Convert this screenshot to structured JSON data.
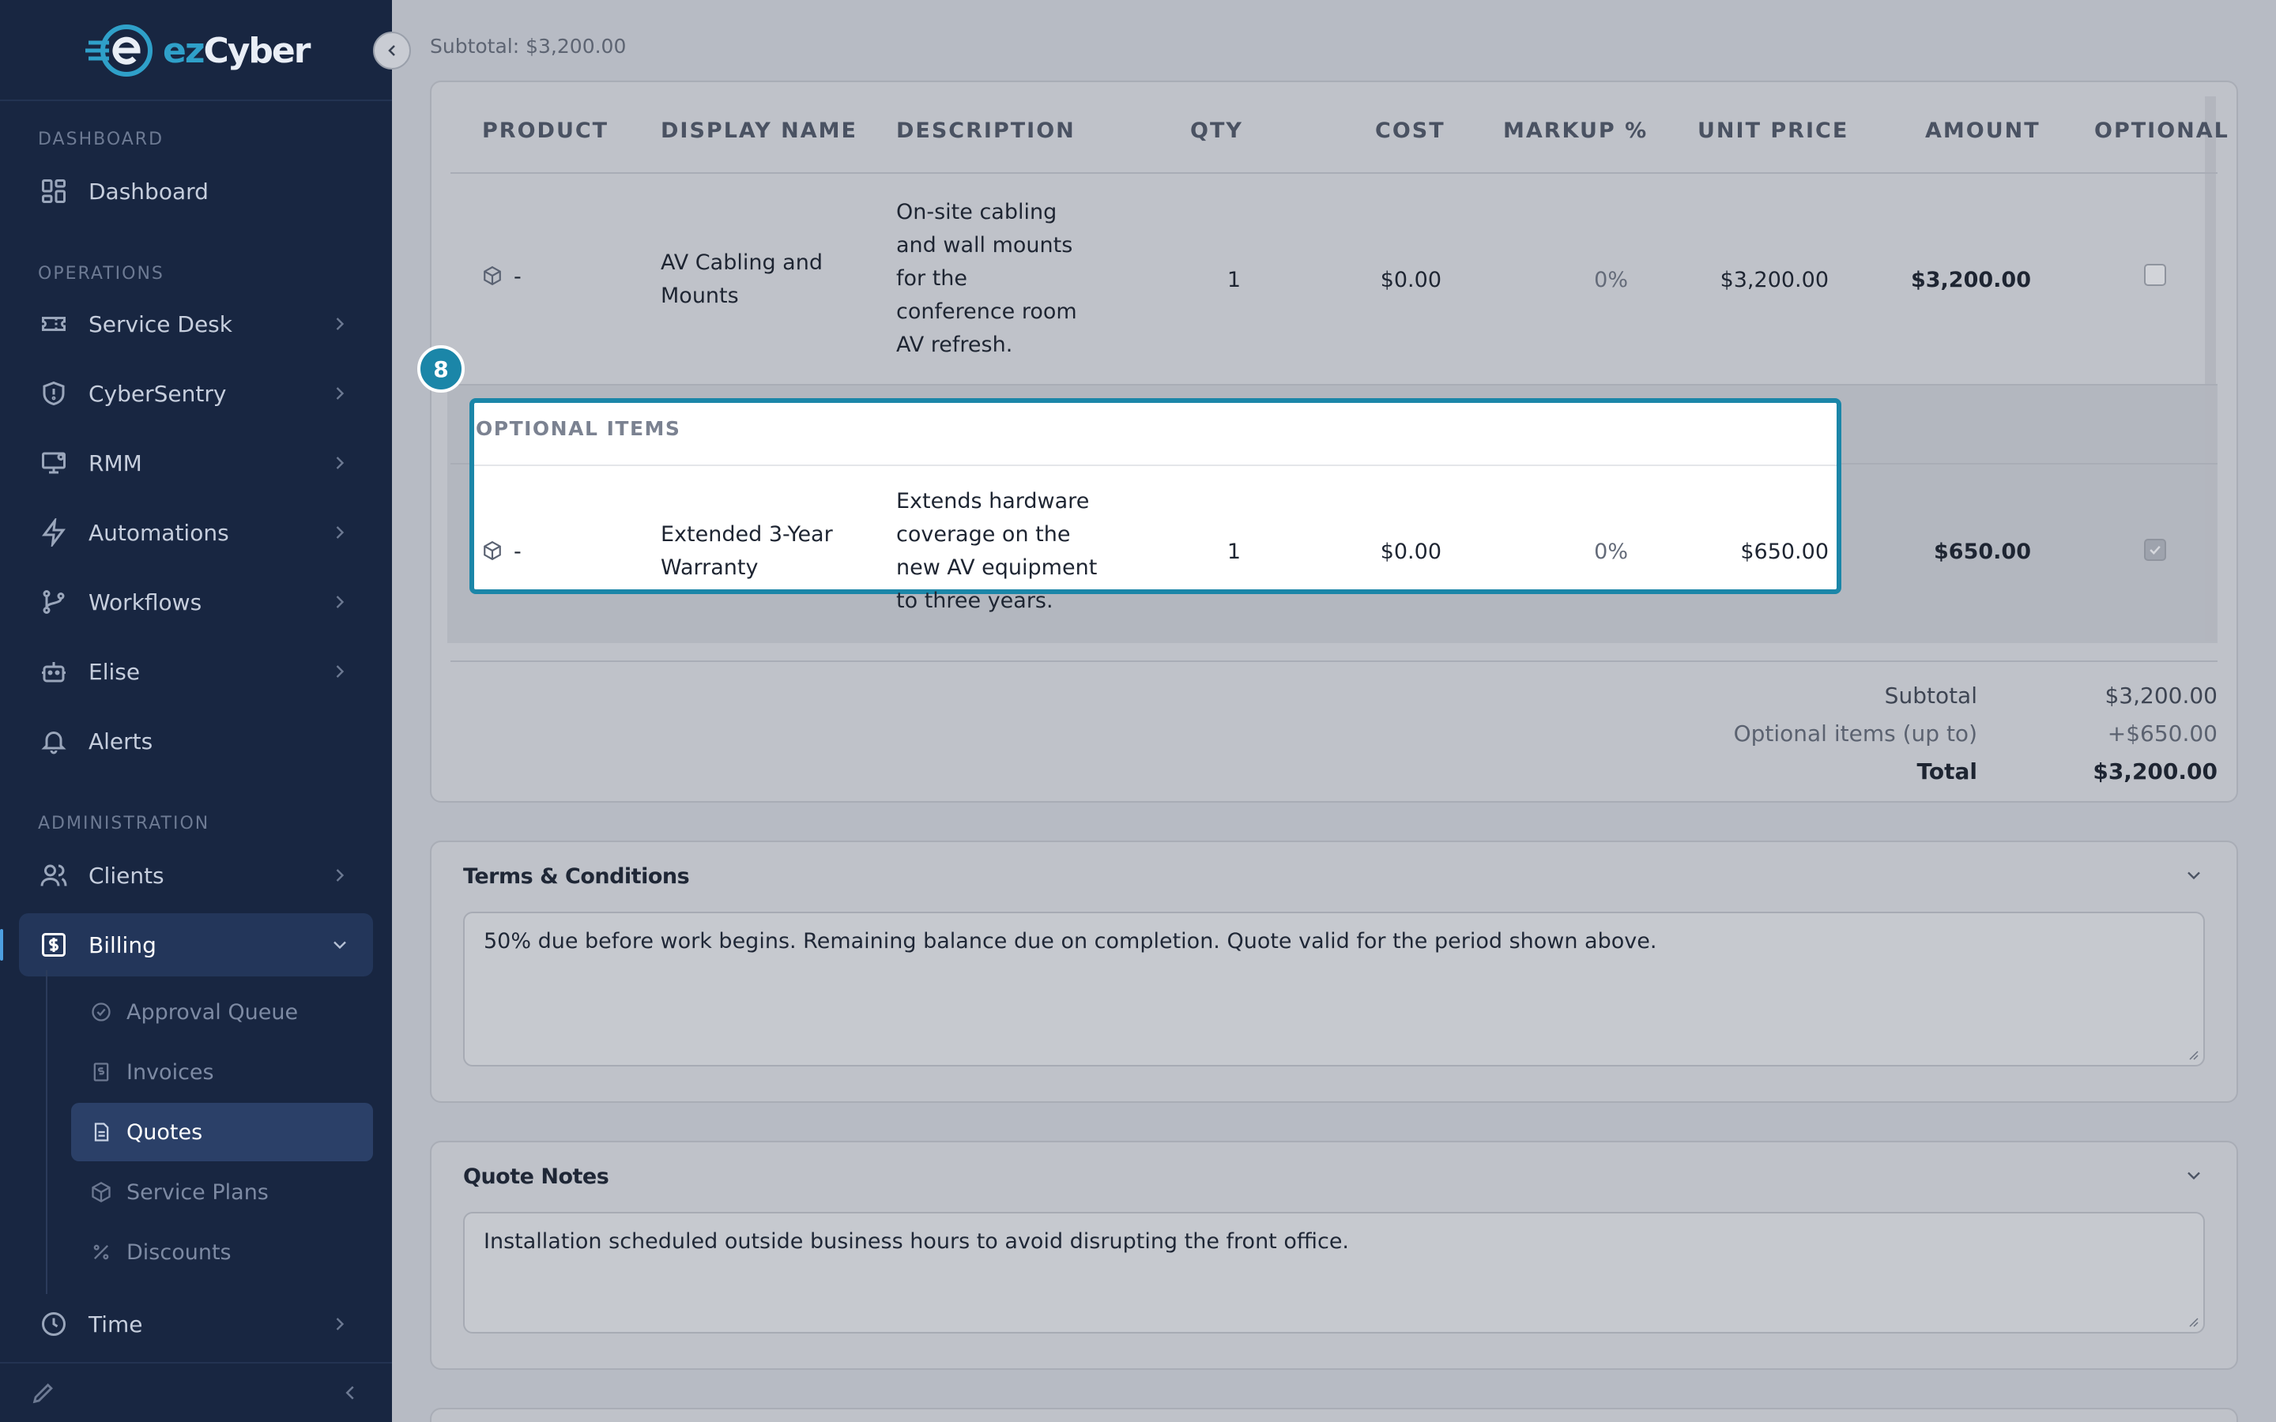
{
  "brand": {
    "part1": "ez",
    "part2": "Cyber"
  },
  "sidebar": {
    "sections": {
      "dashboard": "DASHBOARD",
      "operations": "OPERATIONS",
      "administration": "ADMINISTRATION"
    },
    "items": {
      "dashboard": "Dashboard",
      "service_desk": "Service Desk",
      "cybersentry": "CyberSentry",
      "rmm": "RMM",
      "automations": "Automations",
      "workflows": "Workflows",
      "elise": "Elise",
      "alerts": "Alerts",
      "clients": "Clients",
      "billing": "Billing",
      "time": "Time"
    },
    "billing_sub": {
      "approval_queue": "Approval Queue",
      "invoices": "Invoices",
      "quotes": "Quotes",
      "service_plans": "Service Plans",
      "discounts": "Discounts"
    }
  },
  "main": {
    "subtotal_top": "Subtotal: $3,200.00",
    "table": {
      "headers": {
        "product": "PRODUCT",
        "display_name": "DISPLAY NAME",
        "description": "DESCRIPTION",
        "qty": "QTY",
        "cost": "COST",
        "markup": "MARKUP %",
        "unit_price": "UNIT PRICE",
        "amount": "AMOUNT",
        "optional": "OPTIONAL"
      },
      "rows": [
        {
          "product": "-",
          "display_name_l1": "AV Cabling and",
          "display_name_l2": "Mounts",
          "desc_l1": "On-site cabling",
          "desc_l2": "and wall mounts",
          "desc_l3": "for the",
          "desc_l4": "conference room",
          "desc_l5": "AV refresh.",
          "qty": "1",
          "cost": "$0.00",
          "markup": "0%",
          "unit_price": "$3,200.00",
          "amount": "$3,200.00",
          "optional": false
        }
      ],
      "optional_section_label": "OPTIONAL ITEMS",
      "optional_rows": [
        {
          "product": "-",
          "display_name_l1": "Extended 3-Year",
          "display_name_l2": "Warranty",
          "desc_l1": "Extends hardware",
          "desc_l2": "coverage on the",
          "desc_l3": "new AV equipment",
          "desc_l4": "to three years.",
          "qty": "1",
          "cost": "$0.00",
          "markup": "0%",
          "unit_price": "$650.00",
          "amount": "$650.00",
          "optional": true
        }
      ]
    },
    "highlight_badge": "8",
    "totals": {
      "subtotal_label": "Subtotal",
      "subtotal_value": "$3,200.00",
      "optional_label": "Optional items (up to)",
      "optional_value": "+$650.00",
      "total_label": "Total",
      "total_value": "$3,200.00"
    },
    "terms": {
      "title": "Terms & Conditions",
      "text": "50% due before work begins. Remaining balance due on completion. Quote valid for the period shown above."
    },
    "notes": {
      "title": "Quote Notes",
      "text": "Installation scheduled outside business hours to avoid disrupting the front office."
    }
  },
  "colors": {
    "accent": "#1b86a8",
    "sidebar_bg": "#182641",
    "content_bg": "#b7bbc4"
  }
}
